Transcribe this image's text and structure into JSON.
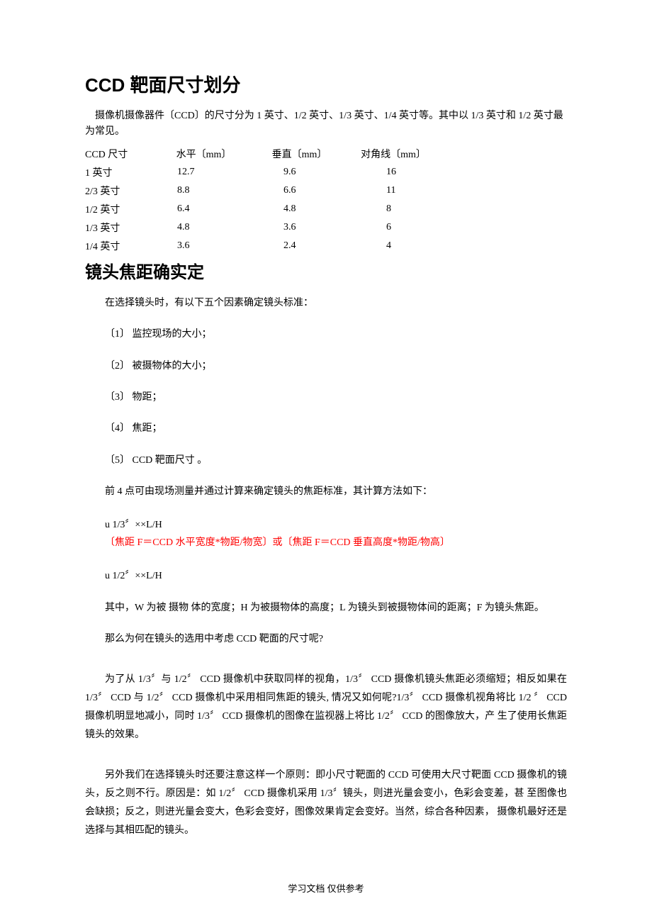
{
  "section1": {
    "title": "CCD 靶面尺寸划分",
    "intro": "摄像机摄像器件〔CCD〕的尺寸分为 1 英寸、1/2 英寸、1/3 英寸、1/4 英寸等。其中以 1/3 英寸和 1/2 英寸最为常见。",
    "table": {
      "headers": {
        "col1": "CCD 尺寸",
        "col2": "水平〔mm〕",
        "col3": "垂直〔mm〕",
        "col4": "对角线〔mm〕"
      },
      "rows": [
        {
          "size": "1 英寸",
          "h": "12.7",
          "v": "9.6",
          "d": "16"
        },
        {
          "size": "2/3 英寸",
          "h": "8.8",
          "v": "6.6",
          "d": "11"
        },
        {
          "size": "1/2 英寸",
          "h": "6.4",
          "v": "4.8",
          "d": "8"
        },
        {
          "size": "1/3 英寸",
          "h": "4.8",
          "v": "3.6",
          "d": "6"
        },
        {
          "size": "1/4 英寸",
          "h": "3.6",
          "v": "2.4",
          "d": "4"
        }
      ]
    }
  },
  "section2": {
    "title": "镜头焦距确实定",
    "p_intro": "在选择镜头时，有以下五个因素确定镜头标准：",
    "items": [
      "〔1〕 监控现场的大小；",
      "〔2〕 被摄物体的大小；",
      "〔3〕 物距；",
      "〔4〕 焦距；",
      "〔5〕 CCD 靶面尺寸 。"
    ],
    "p_calc": "前 4 点可由现场测量并通过计算来确定镜头的焦距标准，其计算方法如下：",
    "formula1": {
      "line1": "u 1/3〞××L/H",
      "line2": "〔焦距 F＝CCD 水平宽度*物距/物宽〕或〔焦距 F＝CCD 垂直高度*物距/物高〕"
    },
    "formula2": "u 1/2〞××L/H",
    "p_where": "其中，W 为被 摄物 体的宽度；H 为被摄物体的高度；L 为镜头到被摄物体间的距离；F 为镜头焦距。",
    "p_why": "那么为何在镜头的选用中考虑 CCD 靶面的尺寸呢?",
    "p_long1": "为了从 1/3〞与 1/2〞 CCD 摄像机中获取同样的视角，1/3〞 CCD 摄像机镜头焦距必须缩短；相反如果在 1/3〞 CCD 与 1/2〞 CCD 摄像机中采用相同焦距的镜头, 情况又如何呢?1/3〞 CCD 摄像机视角将比 1/2 〞 CCD 摄像机明显地减小，同时 1/3〞 CCD 摄像机的图像在监视器上将比 1/2〞 CCD 的图像放大，产   生了使用长焦距镜头的效果。",
    "p_long2": "另外我们在选择镜头时还要注意这样一个原则：即小尺寸靶面的 CCD 可使用大尺寸靶面 CCD 摄像机的镜头，反之则不行。原因是：如 1/2〞 CCD 摄像机采用 1/3〞镜头，则进光量会变小，色彩会变差，甚 至图像也会缺损；反之，则进光量会变大，色彩会变好，图像效果肯定会变好。当然，综合各种因素， 摄像机最好还是选择与其相匹配的镜头。"
  },
  "footer": "学习文档  仅供参考"
}
